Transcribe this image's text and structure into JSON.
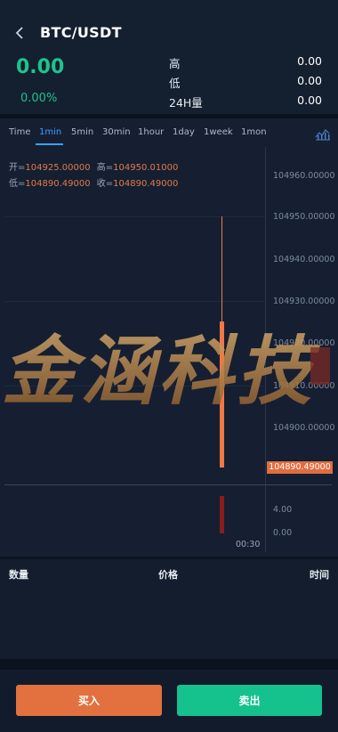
{
  "header": {
    "pair": "BTC/USDT",
    "last_price": "0.00",
    "change_pct": "0.00%",
    "stats": [
      {
        "label": "高",
        "value": "0.00"
      },
      {
        "label": "低",
        "value": "0.00"
      },
      {
        "label": "24H量",
        "value": "0.00"
      }
    ]
  },
  "tabs": [
    "Time",
    "1min",
    "5min",
    "30min",
    "1hour",
    "1day",
    "1week",
    "1mon"
  ],
  "active_tab": "1min",
  "ohlc": {
    "open_label": "开=",
    "open": "104925.00000",
    "high_label": "高=",
    "high": "104950.01000",
    "low_label": "低=",
    "low": "104890.49000",
    "close_label": "收=",
    "close": "104890.49000"
  },
  "price_axis": [
    "104960.00000",
    "104950.00000",
    "104940.00000",
    "104930.00000",
    "104920.00000",
    "104910.00000",
    "104900.00000"
  ],
  "current_price_tag": "104890.49000",
  "volume_axis": [
    "4.00",
    "0.00"
  ],
  "time_label": "00:30",
  "watermark_text": "金涵科技",
  "trades": {
    "headers": {
      "qty": "数量",
      "price": "价格",
      "time": "时间"
    }
  },
  "actions": {
    "buy": "买入",
    "sell": "卖出"
  },
  "colors": {
    "up": "#1dc48c",
    "down": "#e2713f",
    "accent": "#3aa0ff"
  }
}
